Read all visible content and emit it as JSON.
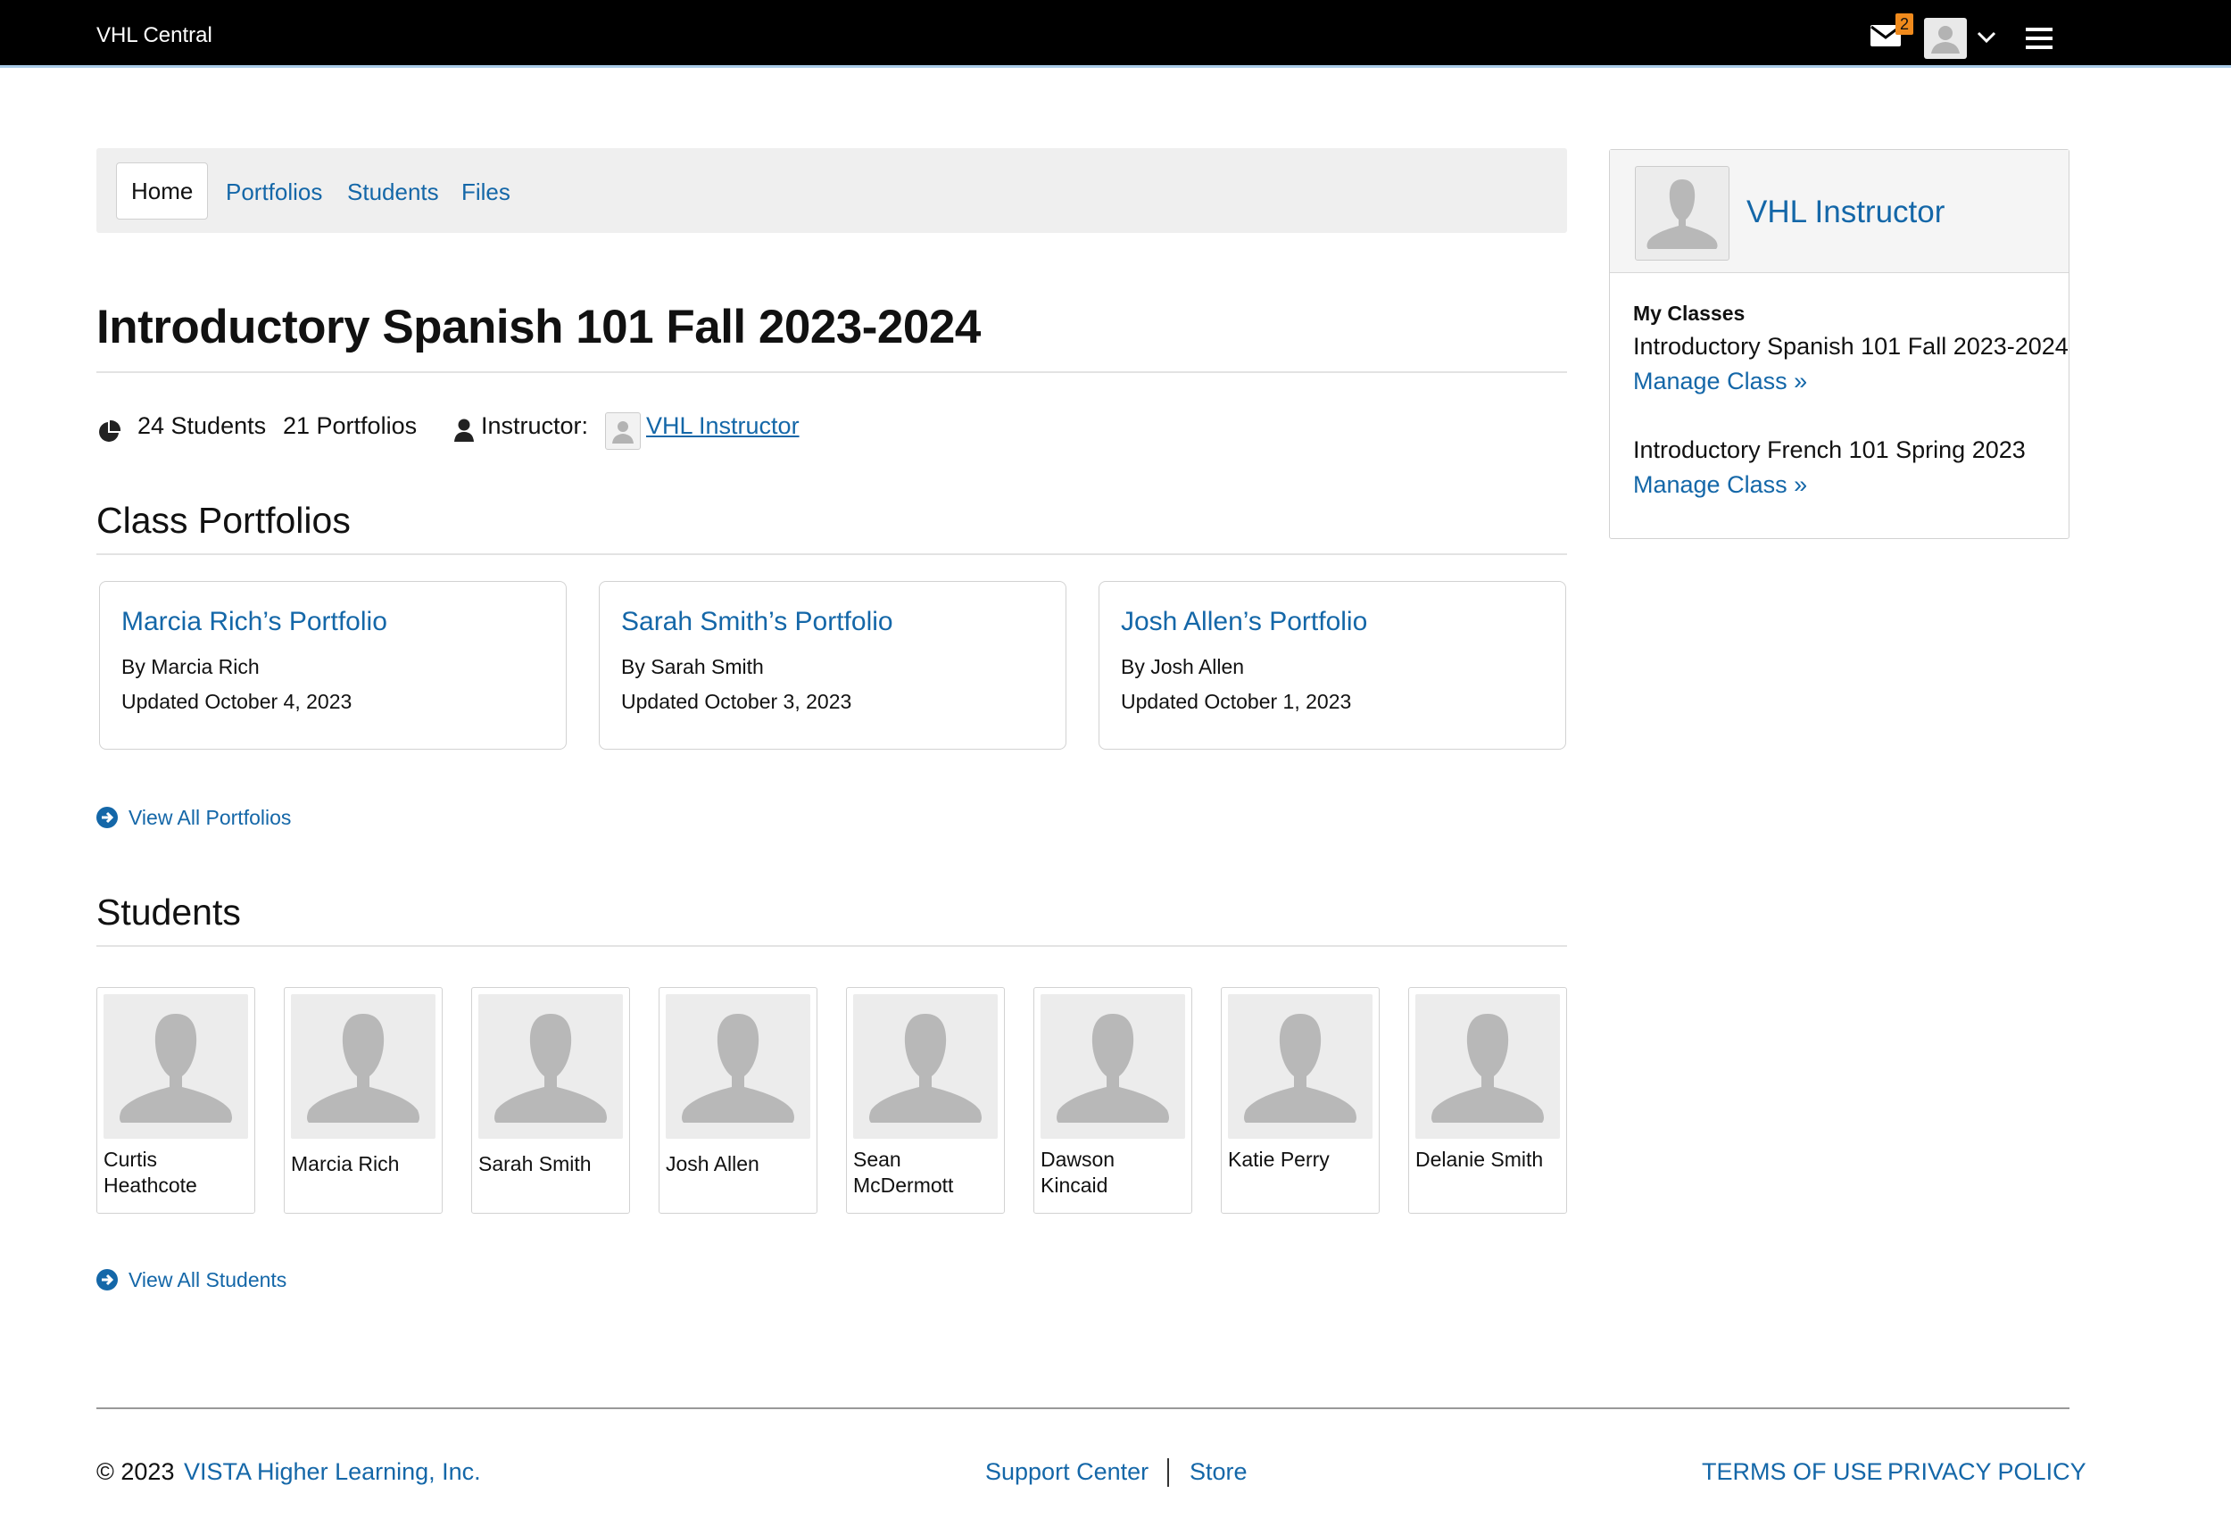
{
  "topbar": {
    "brand": "VHL Central",
    "mail_badge": "2",
    "icons": [
      "mail-icon",
      "avatar",
      "chevron-down-icon",
      "hamburger-menu-icon"
    ]
  },
  "nav": {
    "tabs": [
      {
        "label": "Home",
        "active": true
      },
      {
        "label": "Portfolios",
        "active": false
      },
      {
        "label": "Students",
        "active": false
      },
      {
        "label": "Files",
        "active": false
      }
    ]
  },
  "page": {
    "title": "Introductory Spanish 101 Fall 2023-2024",
    "students_count": "24 Students",
    "portfolios_count": "21 Portfolios",
    "instructor_label": "Instructor:",
    "instructor_name": "VHL Instructor"
  },
  "portfolios": {
    "heading": "Class Portfolios",
    "items": [
      {
        "title": "Marcia Rich’s Portfolio",
        "by": "By Marcia Rich",
        "updated": "Updated October 4, 2023"
      },
      {
        "title": "Sarah Smith’s Portfolio",
        "by": "By Sarah Smith",
        "updated": "Updated October 3, 2023"
      },
      {
        "title": "Josh Allen’s Portfolio",
        "by": "By Josh Allen",
        "updated": "Updated October 1, 2023"
      }
    ],
    "view_all": "View All Portfolios"
  },
  "students": {
    "heading": "Students",
    "items": [
      {
        "name": "Curtis Heathcote"
      },
      {
        "name": "Marcia Rich"
      },
      {
        "name": "Sarah Smith"
      },
      {
        "name": "Josh Allen"
      },
      {
        "name": "Sean McDermott"
      },
      {
        "name": "Dawson Kincaid"
      },
      {
        "name": "Katie Perry"
      },
      {
        "name": "Delanie Smith"
      }
    ],
    "view_all": "View All Students"
  },
  "sidebar": {
    "name": "VHL Instructor",
    "my_classes_label": "My Classes",
    "classes": [
      {
        "name": "Introductory Spanish 101 Fall 2023-2024",
        "manage": "Manage Class »"
      },
      {
        "name": "Introductory French 101 Spring 2023",
        "manage": "Manage Class »"
      }
    ]
  },
  "footer": {
    "copyright": "© 2023",
    "company": "VISTA Higher Learning, Inc.",
    "support": "Support Center",
    "store": "Store",
    "terms": "TERMS OF USE",
    "privacy": "PRIVACY POLICY"
  },
  "colors": {
    "link": "#1467a8",
    "topbar": "#000000",
    "badge": "#f08a1c"
  }
}
